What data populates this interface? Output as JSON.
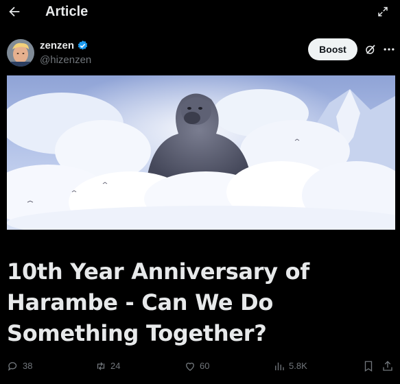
{
  "header": {
    "title": "Article",
    "back_icon": "arrow-left-icon",
    "expand_icon": "expand-icon"
  },
  "author": {
    "name": "zenzen",
    "handle": "@hizenzen",
    "verified_color": "#1d9bf0"
  },
  "controls": {
    "boost_label": "Boost",
    "grok_icon": "grok-icon",
    "more_icon": "more-icon"
  },
  "article": {
    "headline": "10th Year Anniversary of Harambe - Can We Do Something Together?"
  },
  "metrics": {
    "replies": "38",
    "reposts": "24",
    "likes": "60",
    "views": "5.8K"
  }
}
